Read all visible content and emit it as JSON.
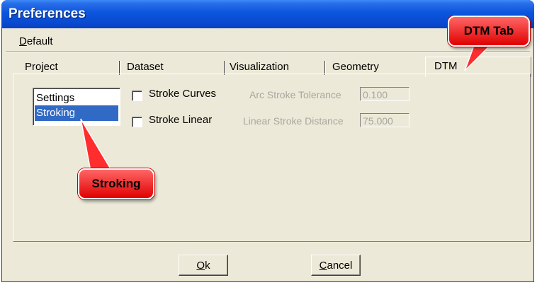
{
  "window": {
    "title": "Preferences"
  },
  "menu": {
    "default_label": "Default",
    "default_accel": "D",
    "default_rest": "efault"
  },
  "tabs": [
    {
      "label": "Project"
    },
    {
      "label": "Dataset"
    },
    {
      "label": "Visualization"
    },
    {
      "label": "Geometry"
    },
    {
      "label": "DTM",
      "active": true
    }
  ],
  "dtm": {
    "list": [
      {
        "label": "Settings",
        "selected": false
      },
      {
        "label": "Stroking",
        "selected": true
      }
    ],
    "stroke_curves": {
      "label": "Stroke Curves",
      "checked": false
    },
    "stroke_linear": {
      "label": "Stroke Linear",
      "checked": false
    },
    "arc_tolerance": {
      "label": "Arc Stroke Tolerance",
      "value": "0.100",
      "enabled": false
    },
    "linear_distance": {
      "label": "Linear Stroke Distance",
      "value": "75.000",
      "enabled": false
    }
  },
  "buttons": {
    "ok": {
      "label": "Ok",
      "accel": "O",
      "rest": "k"
    },
    "cancel": {
      "label": "Cancel",
      "accel": "C",
      "rest": "ancel"
    }
  },
  "callouts": {
    "dtm_tab": "DTM Tab",
    "stroking": "Stroking"
  },
  "colors": {
    "titlebar": "#0b55dd",
    "selection": "#316ac5",
    "callout": "#ff3b3b",
    "dialog_bg": "#ece9d8"
  }
}
